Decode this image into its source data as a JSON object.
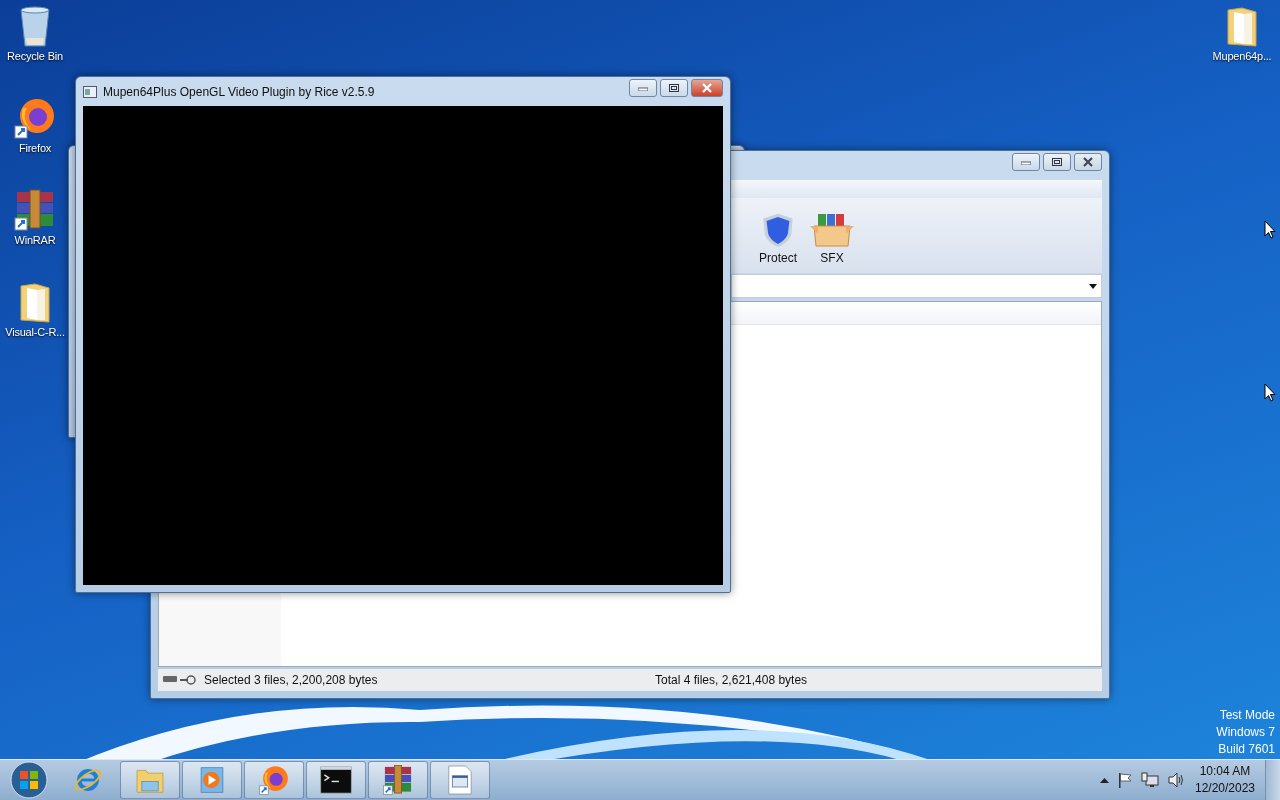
{
  "desktop_icons_left": [
    {
      "label": "Recycle Bin",
      "kind": "recycle"
    },
    {
      "label": "Firefox",
      "kind": "firefox"
    },
    {
      "label": "WinRAR",
      "kind": "winrar"
    },
    {
      "label": "Visual-C-R...",
      "kind": "folder"
    }
  ],
  "desktop_icons_right": [
    {
      "label": "Mupen64p...",
      "kind": "folder"
    }
  ],
  "archiver_window": {
    "toolbar": [
      {
        "label": "Protect",
        "kind": "shield"
      },
      {
        "label": "SFX",
        "kind": "sfx"
      }
    ],
    "status_left": "Selected 3 files, 2,200,208 bytes",
    "status_right": "Total 4 files, 2,621,408 bytes"
  },
  "video_window": {
    "title": "Mupen64Plus OpenGL Video Plugin by Rice v2.5.9"
  },
  "taskbar": {
    "items": [
      {
        "kind": "ie",
        "open": false
      },
      {
        "kind": "explorer",
        "open": true
      },
      {
        "kind": "media",
        "open": true
      },
      {
        "kind": "firefox",
        "open": true
      },
      {
        "kind": "cmd",
        "open": true
      },
      {
        "kind": "winrar",
        "open": true
      },
      {
        "kind": "app",
        "open": true
      }
    ],
    "clock": {
      "time": "10:04 AM",
      "date": "12/20/2023"
    }
  },
  "test_mode_notice": [
    "Test Mode",
    "Windows 7",
    "Build 7601"
  ]
}
